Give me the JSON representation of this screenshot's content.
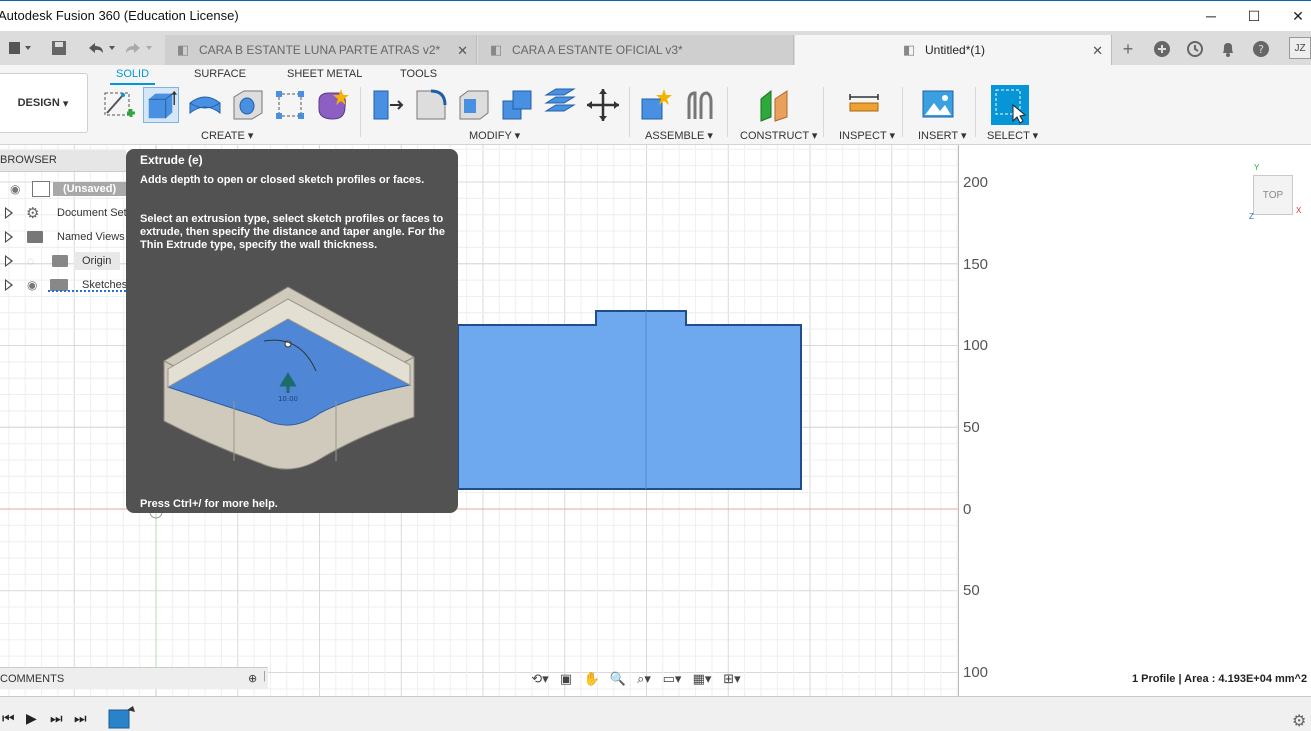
{
  "window": {
    "title": "Autodesk Fusion 360 (Education License)",
    "minimize": "─",
    "maximize": "☐",
    "close": "✕"
  },
  "tabs": [
    {
      "label": "CARA  B ESTANTE LUNA PARTE ATRAS v2*",
      "active": false
    },
    {
      "label": "CARA A ESTANTE OFICIAL v3*",
      "active": false
    },
    {
      "label": "Untitled*(1)",
      "active": true
    }
  ],
  "user_initials": "JZ",
  "toolbar": {
    "workspace": "DESIGN",
    "workspace_tabs": [
      "SOLID",
      "SURFACE",
      "SHEET METAL",
      "TOOLS"
    ],
    "active_tab": "SOLID",
    "groups": [
      "CREATE",
      "MODIFY",
      "ASSEMBLE",
      "CONSTRUCT",
      "INSPECT",
      "INSERT",
      "SELECT"
    ]
  },
  "browser": {
    "header": "BROWSER",
    "items": [
      {
        "label": "(Unsaved)"
      },
      {
        "label": "Document Settings"
      },
      {
        "label": "Named Views"
      },
      {
        "label": "Origin"
      },
      {
        "label": "Sketches"
      }
    ]
  },
  "tooltip": {
    "title": "Extrude (e)",
    "p1": "Adds depth to open or closed sketch profiles or faces.",
    "p2": "Select an extrusion type, select sketch profiles or faces to extrude, then specify the distance and taper angle. For the Thin Extrude type, specify the wall thickness.",
    "dimension": "10.00",
    "footer": "Press Ctrl+/ for more help."
  },
  "ruler_ticks": [
    "200",
    "150",
    "100",
    "50",
    "0",
    "50",
    "100"
  ],
  "viewcube": "TOP",
  "axis_labels": {
    "y": "Y",
    "x": "X",
    "z": "Z"
  },
  "comments": "COMMENTS",
  "status": "1 Profile | Area : 4.193E+04 mm^2",
  "colors": {
    "accent": "#0696d7",
    "profile_fill": "#6ea9f0",
    "profile_stroke": "#1f4e8a",
    "tooltip_bg": "#525252"
  }
}
